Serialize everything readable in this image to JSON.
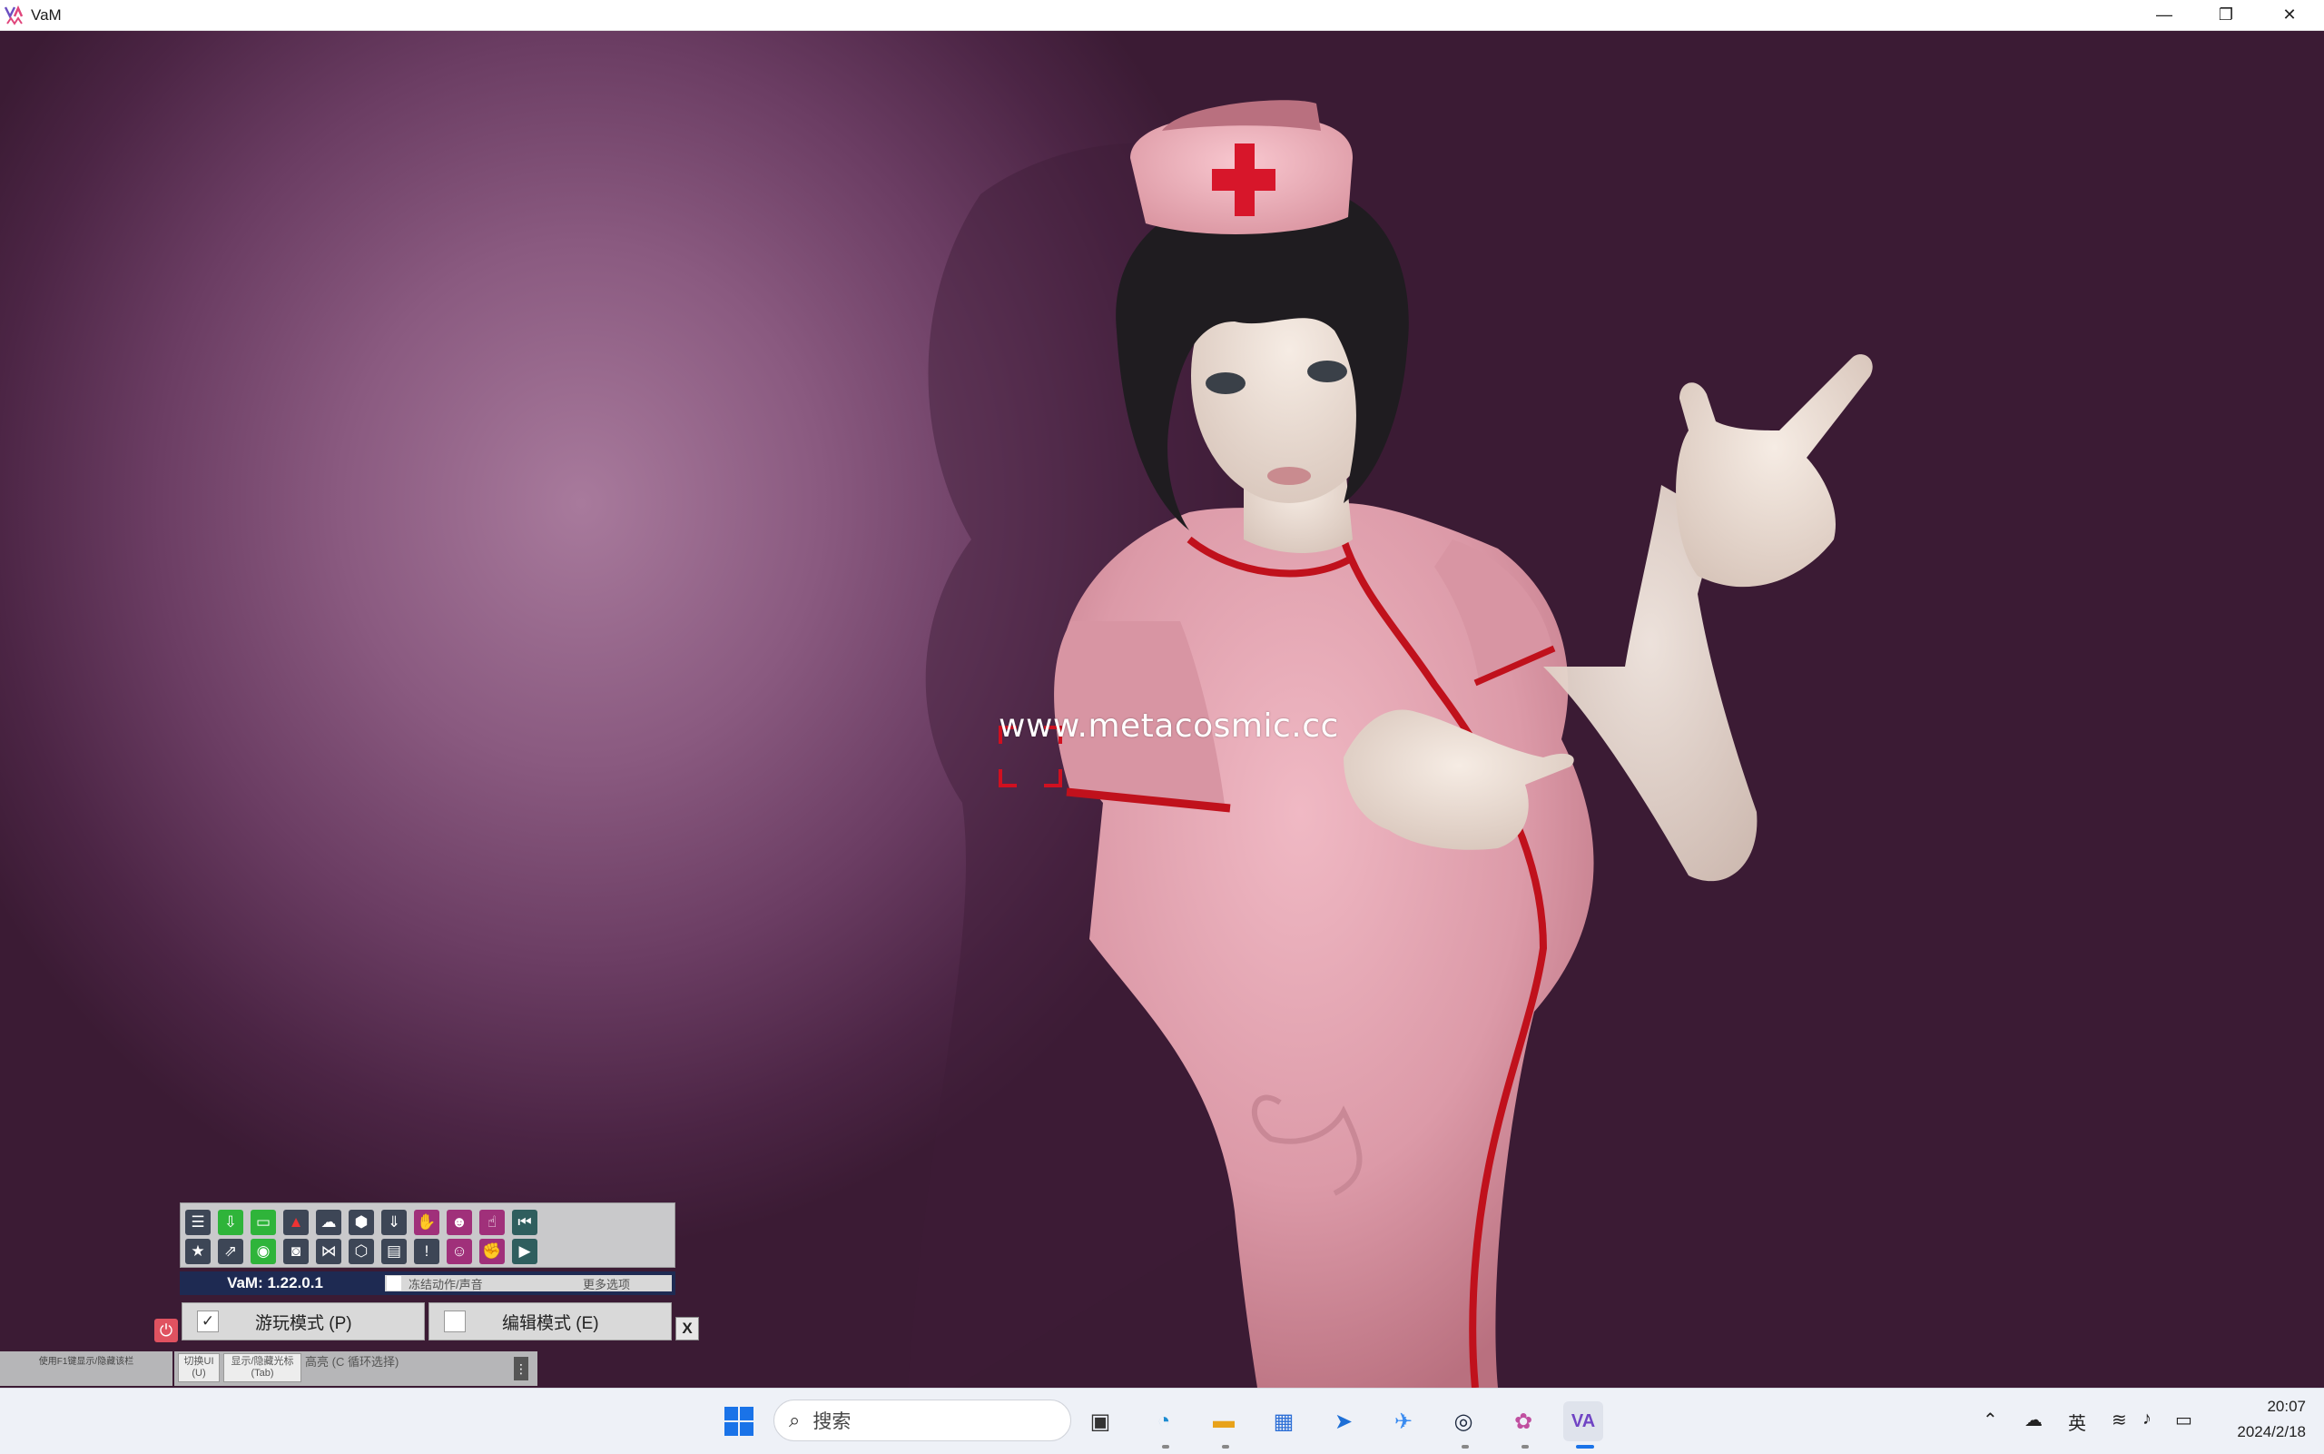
{
  "window": {
    "title": "VaM",
    "minimize_glyph": "—",
    "restore_glyph": "❐",
    "close_glyph": "✕"
  },
  "viewport": {
    "watermark": "www.metacosmic.cc",
    "hat_cross_color": "#d7162a",
    "dress_color": "#dfa0ad",
    "trim_color": "#c0111c",
    "hair_color": "#1e1c1f"
  },
  "vam_panel": {
    "toolbar_row1_icons": [
      "menu-icon",
      "download-scene-icon",
      "folder-icon",
      "hub-icon",
      "cloud-icon",
      "package-icon",
      "import-icon",
      "hand-icon",
      "person-add-icon",
      "pointer-icon",
      "skip-back-icon"
    ],
    "toolbar_row2_icons": [
      "star-icon",
      "load-look-icon",
      "screenshot-icon",
      "camera-icon",
      "nodes-icon",
      "packages-icon",
      "file-icon",
      "alert-icon",
      "person-edit-icon",
      "grab-icon",
      "play-icon"
    ],
    "version_label": "VaM: 1.22.0.1",
    "freeze_label": "冻结动作/声音",
    "more_options_label": "更多选项",
    "play_mode_label": "游玩模式 (P)",
    "play_mode_checked": "✓",
    "edit_mode_label": "编辑模式 (E)",
    "close_label": "X",
    "power_glyph": "⏻"
  },
  "hints": {
    "left_hint": "使用F1键显示/隐藏该栏",
    "toggle_ui": "切换UI\n(U)",
    "show_cursor": "显示/隐藏光标\n(Tab)",
    "highlight": "高亮 (C 循环选择)",
    "more_glyph": "⋮"
  },
  "taskbar": {
    "search_placeholder": "搜索",
    "clock_time": "20:07",
    "clock_date": "2024/2/18",
    "ime_label": "英"
  }
}
